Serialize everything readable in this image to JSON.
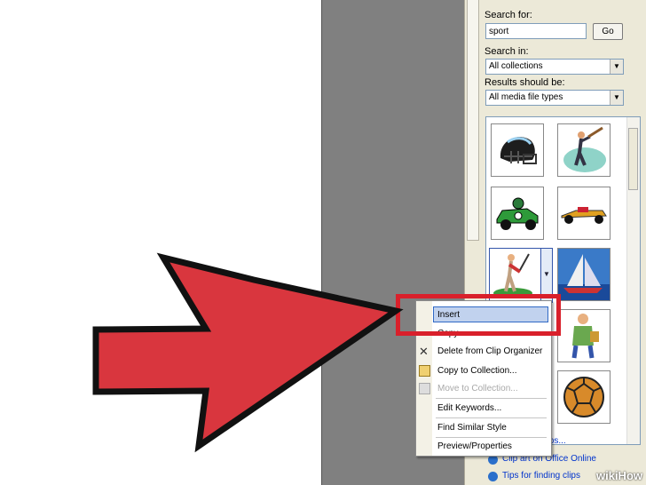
{
  "task_pane": {
    "search_for_label": "Search for:",
    "search_value": "sport",
    "go_label": "Go",
    "search_in_label": "Search in:",
    "search_in_value": "All collections",
    "results_label": "Results should be:",
    "results_value": "All media file types"
  },
  "context_menu": {
    "insert": "Insert",
    "copy": "Copy",
    "delete": "Delete from Clip Organizer",
    "copy_to": "Copy to Collection...",
    "move_to": "Move to Collection...",
    "edit_keywords": "Edit Keywords...",
    "find_similar": "Find Similar Style",
    "preview": "Preview/Properties"
  },
  "bottom_links": {
    "office_online": "Clip art on Office Online",
    "tips": "Tips for finding clips",
    "organize": "Organize clips..."
  },
  "watermark": "wikiHow",
  "colors": {
    "arrow_red": "#d9363e",
    "highlight_box": "#d9202b",
    "menu_highlight": "#c1d2ee"
  }
}
